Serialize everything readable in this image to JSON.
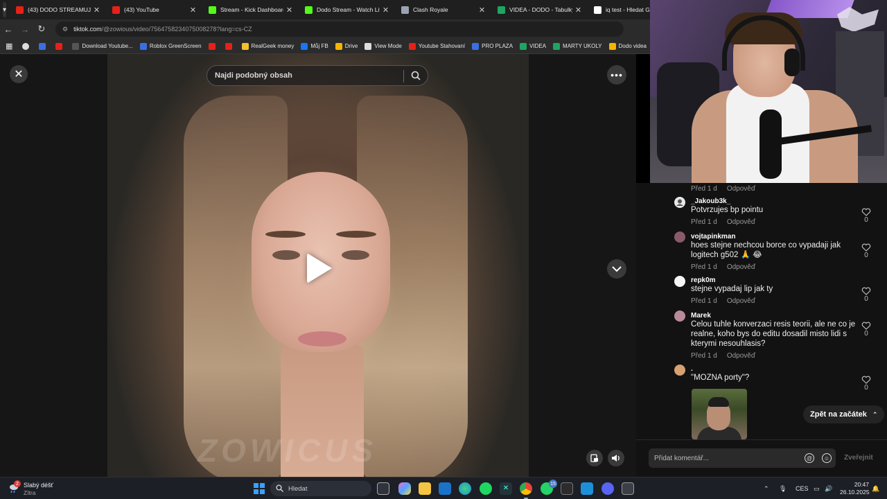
{
  "browser": {
    "tabs": [
      {
        "label": "(43) DODO STREAMUJE -",
        "icon": "youtube-icon",
        "color": "#e62117"
      },
      {
        "label": "(43) YouTube",
        "icon": "youtube-icon",
        "color": "#e62117"
      },
      {
        "label": "Stream - Kick Dashboard",
        "icon": "kick-icon",
        "color": "#53fc18"
      },
      {
        "label": "Dodo Stream - Watch Live",
        "icon": "kick-icon",
        "color": "#53fc18"
      },
      {
        "label": "Clash Royale",
        "icon": "page-icon",
        "color": "#9aa4b0"
      },
      {
        "label": "VIDEA - DODO - Tabulky",
        "icon": "sheets-icon",
        "color": "#1fa463"
      },
      {
        "label": "iq test - Hledat G",
        "icon": "google-icon",
        "color": "#ffffff"
      }
    ],
    "url_host": "tiktok.com",
    "url_path": "/@zowious/video/7564758234075008278?lang=cs-CZ",
    "bookmarks": [
      {
        "label": "",
        "icon": "youtube-icon",
        "color": "#e62117"
      },
      {
        "label": "Download Youtube...",
        "icon": "page-icon",
        "color": "#555555"
      },
      {
        "label": "Roblox GreenScreen",
        "icon": "roblox-icon",
        "color": "#3b6fe0"
      },
      {
        "label": "",
        "icon": "youtube-icon",
        "color": "#e62117"
      },
      {
        "label": "",
        "icon": "youtube-icon",
        "color": "#e62117"
      },
      {
        "label": "RealGeek money",
        "icon": "lightbulb-icon",
        "color": "#f2c12e"
      },
      {
        "label": "Můj FB",
        "icon": "facebook-icon",
        "color": "#1877f2"
      },
      {
        "label": "Drive",
        "icon": "drive-icon",
        "color": "#f4b400"
      },
      {
        "label": "View Mode",
        "icon": "page-icon",
        "color": "#dddddd"
      },
      {
        "label": "Youtube Stahovaní",
        "icon": "download-icon",
        "color": "#e62117"
      },
      {
        "label": "PRO PLAZA",
        "icon": "roblox-icon",
        "color": "#3b6fe0"
      },
      {
        "label": "VIDEA",
        "icon": "sheets-icon",
        "color": "#1fa463"
      },
      {
        "label": "MARTY UKOLY",
        "icon": "sheets-icon",
        "color": "#1fa463"
      },
      {
        "label": "Dodo videa",
        "icon": "drive-icon",
        "color": "#f4b400"
      }
    ]
  },
  "viewer": {
    "search_placeholder": "Najdi podobný obsah",
    "watermark": "ZOWICUS"
  },
  "comments": {
    "top_meta": {
      "time": "Před 1 d",
      "reply": "Odpověď"
    },
    "items": [
      {
        "user": "_Jakoub3k_",
        "text": "Potvrzujes bp pointu",
        "time": "Před 1 d",
        "reply": "Odpověď",
        "likes": "0",
        "avatar_color": "#e8e8e8"
      },
      {
        "user": "vojtapinkman",
        "text": "hoes stejne nechcou borce co vypadaji jak logitech g502 🙏 😂",
        "time": "Před 1 d",
        "reply": "Odpověď",
        "likes": "0",
        "avatar_color": "#8a5a6a"
      },
      {
        "user": "repk0m",
        "text": "stejne vypadaj lip jak ty",
        "time": "Před 1 d",
        "reply": "Odpověď",
        "likes": "0",
        "avatar_color": "#f5f5f5"
      },
      {
        "user": "Marek",
        "text": "Celou tuhle konverzaci resis teorii, ale ne co je realne, koho bys do editu dosadil misto lidi s kterymi nesouhlasis?",
        "time": "Před 1 d",
        "reply": "Odpověď",
        "likes": "0",
        "avatar_color": "#b98a9a"
      },
      {
        "user": ".",
        "text": "\"MOZNA porty\"?",
        "likes": "0",
        "avatar_color": "#d9a070"
      }
    ],
    "back_to_top": "Zpět na začátek",
    "input_placeholder": "Přidat komentář...",
    "publish_label": "Zveřejnit"
  },
  "taskbar": {
    "weather_title": "Slabý déšť",
    "weather_sub": "Zítra",
    "weather_badge": "2",
    "search_placeholder": "Hledat",
    "whatsapp_badge": "15",
    "language": "CES",
    "time": "20:47",
    "date": "26.10.2025"
  }
}
